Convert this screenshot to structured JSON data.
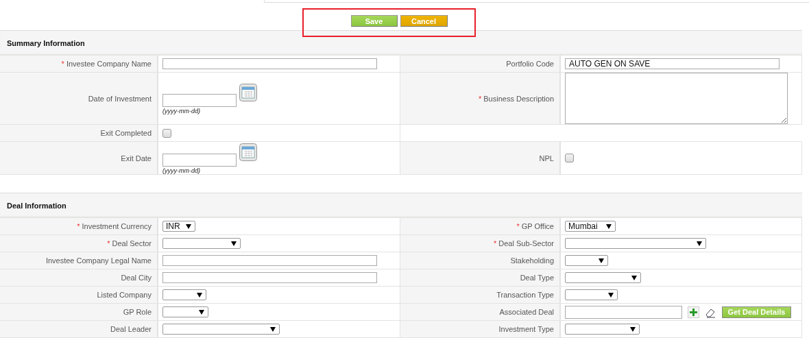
{
  "actions": {
    "highlighted": true,
    "buttons": [
      {
        "label": "Save",
        "kind": "save"
      },
      {
        "label": "Cancel",
        "kind": "cancel"
      }
    ]
  },
  "sections": [
    {
      "title": "Summary Information",
      "rows": [
        [
          {
            "marker": "*",
            "label": "Investee Company Name",
            "kind": "text"
          },
          {
            "label": "Portfolio Code",
            "kind": "text",
            "value": "AUTO GEN ON SAVE"
          }
        ],
        [
          {
            "label": "Date of Investment",
            "kind": "date",
            "hint": "(yyyy-mm-dd)"
          },
          {
            "marker": "*",
            "label": "Business Description",
            "kind": "textarea"
          }
        ],
        [
          {
            "label": "Exit Completed",
            "kind": "checkbox",
            "checked": false
          }
        ],
        [
          {
            "label": "Exit Date",
            "kind": "date",
            "hint": "(yyyy-mm-dd)"
          },
          {
            "label": "NPL",
            "kind": "checkbox",
            "checked": false
          }
        ]
      ]
    },
    {
      "title": "Deal Information",
      "rows": [
        [
          {
            "marker": "*",
            "label": "Investment Currency",
            "kind": "select",
            "value": "INR"
          },
          {
            "marker": "*",
            "label": "GP Office",
            "kind": "select",
            "value": "Mumbai"
          }
        ],
        [
          {
            "marker": "*",
            "label": "Deal Sector",
            "kind": "select"
          },
          {
            "marker": "*",
            "label": "Deal Sub-Sector",
            "kind": "select"
          }
        ],
        [
          {
            "label": "Investee Company Legal Name",
            "kind": "text"
          },
          {
            "label": "Stakeholding",
            "kind": "select"
          }
        ],
        [
          {
            "label": "Deal City",
            "kind": "text"
          },
          {
            "label": "Deal Type",
            "kind": "select"
          }
        ],
        [
          {
            "label": "Listed Company",
            "kind": "select"
          },
          {
            "label": "Transaction Type",
            "kind": "select"
          }
        ],
        [
          {
            "label": "GP Role",
            "kind": "select"
          },
          {
            "label": "Associated Deal",
            "kind": "associated",
            "button": "Get Deal Details"
          }
        ],
        [
          {
            "label": "Deal Leader",
            "kind": "select"
          },
          {
            "label": "Investment Type",
            "kind": "select"
          }
        ]
      ]
    }
  ]
}
